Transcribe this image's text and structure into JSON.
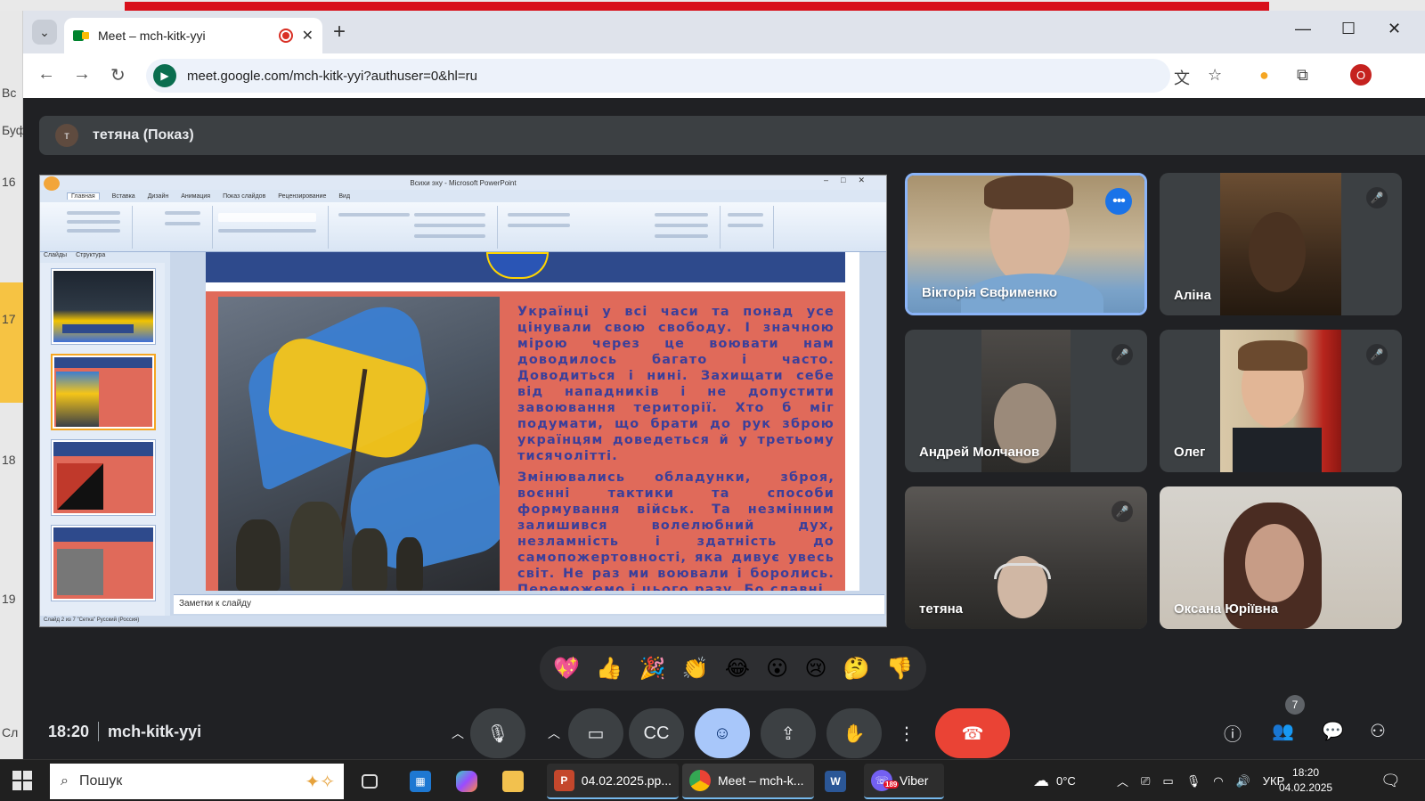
{
  "browser": {
    "tab_title": "Meet – mch-kitk-yyi",
    "url": "meet.google.com/mch-kitk-yyi?authuser=0&hl=ru",
    "profile_initial": "О"
  },
  "meet": {
    "presenter_initial": "т",
    "presenter_label": "тетяна (Показ)",
    "time": "18:20",
    "meeting_code": "mch-kitk-yyi",
    "participant_count": "7",
    "participants": [
      {
        "name": "Вікторія Євфименко",
        "muted": false,
        "speaking": true
      },
      {
        "name": "Аліна",
        "muted": true
      },
      {
        "name": "Андрей Молчанов",
        "muted": true
      },
      {
        "name": "Олег",
        "muted": true
      },
      {
        "name": "тетяна",
        "muted": true
      },
      {
        "name": "Оксана Юріївна",
        "muted": false
      }
    ],
    "reactions": [
      "💖",
      "👍",
      "🎉",
      "👏",
      "😂",
      "😮",
      "😢",
      "🤔",
      "👎"
    ]
  },
  "shared_screen": {
    "window_title": "Всихи эху - Microsoft PowerPoint",
    "ribbon_tabs": [
      "Главная",
      "Вставка",
      "Дизайн",
      "Анимация",
      "Показ слайдов",
      "Рецензирование",
      "Вид"
    ],
    "side_tabs": [
      "Слайды",
      "Структура"
    ],
    "notes_placeholder": "Заметки к слайду",
    "status_bar": "Слайд 2 из 7   \"Сетка\"   Русский (Россия)",
    "slide_text_p1": "Українці у всі часи та понад усе цінували свою свободу. І значною мірою через це воювати нам доводилось багато і часто. Доводиться і нині. Захищати себе від нападників і не допустити завоювання території. Хто б міг подумати, що брати до рук зброю українцям доведеться й у третьому тисячолітті.",
    "slide_text_p2": "Змінювались обладунки, зброя, воєнні тактики та способи формування військ. Та незмінним залишився волелюбний дух, незламність і здатність до самопожертовності, яка дивує увесь світ. Не раз ми воювали і боролись. Переможемо і цього разу. Бо славні"
  },
  "taskbar": {
    "search_placeholder": "Пошук",
    "apps": [
      {
        "label": "04.02.2025.pp..."
      },
      {
        "label": "Meet – mch-k..."
      },
      {
        "label": "Viber",
        "badge": "189"
      }
    ],
    "weather": "0°C",
    "lang": "УКР",
    "time": "18:20",
    "date": "04.02.2025"
  }
}
